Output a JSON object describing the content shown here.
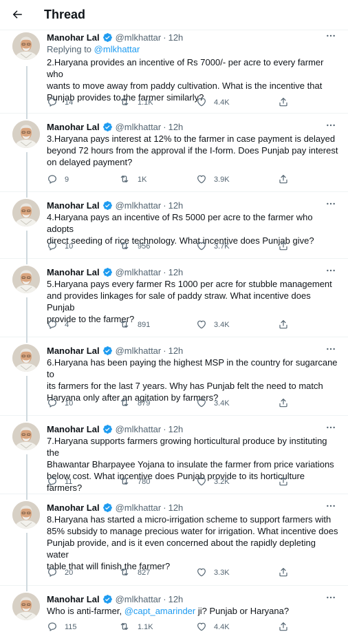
{
  "header": {
    "title": "Thread"
  },
  "colors": {
    "accent": "#1d9bf0",
    "text": "#0f1419",
    "secondary": "#536471",
    "divider": "#eff3f4"
  },
  "icons": {
    "back": "arrow-left-icon",
    "verified": "verified-badge-icon",
    "more": "more-horizontal-icon",
    "reply": "reply-icon",
    "retweet": "retweet-icon",
    "like": "heart-icon",
    "share": "share-icon"
  },
  "tweets": [
    {
      "name": "Manohar Lal",
      "handle": "@mlkhattar",
      "time": "12h",
      "replying_prefix": "Replying to",
      "replying_to": "@mlkhattar",
      "lines": [
        "2.Haryana provides an incentive of Rs 7000/- per acre to every farmer who",
        "wants to move away from paddy cultivation. What is the incentive that",
        "Punjab provides to the farmer similarly?"
      ],
      "replies": "14",
      "retweets": "1.1K",
      "likes": "4.4K"
    },
    {
      "name": "Manohar Lal",
      "handle": "@mlkhattar",
      "time": "12h",
      "lines": [
        "3.Haryana pays interest at 12% to the farmer in case payment is delayed",
        "beyond 72 hours from the approval if the I-form. Does Punjab pay interest",
        "on delayed payment?"
      ],
      "replies": "9",
      "retweets": "1K",
      "likes": "3.9K"
    },
    {
      "name": "Manohar Lal",
      "handle": "@mlkhattar",
      "time": "12h",
      "lines": [
        "4.Haryana pays an incentive of Rs 5000 per acre to the farmer who adopts",
        "direct seeding of rice technology. What incentive does Punjab give?"
      ],
      "replies": "10",
      "retweets": "956",
      "likes": "3.7K"
    },
    {
      "name": "Manohar Lal",
      "handle": "@mlkhattar",
      "time": "12h",
      "lines": [
        "5.Haryana pays every farmer Rs 1000 per acre for stubble management",
        "and provides linkages for sale of paddy straw. What incentive does Punjab",
        "provide to the farmer?"
      ],
      "replies": "4",
      "retweets": "891",
      "likes": "3.4K"
    },
    {
      "name": "Manohar Lal",
      "handle": "@mlkhattar",
      "time": "12h",
      "lines": [
        "6.Haryana has been paying the highest MSP in the country for sugarcane to",
        "its farmers for the last 7 years. Why has Punjab felt the need to match",
        "Haryana only after an agitation by farmers?"
      ],
      "replies": "10",
      "retweets": "879",
      "likes": "3.4K"
    },
    {
      "name": "Manohar Lal",
      "handle": "@mlkhattar",
      "time": "12h",
      "lines": [
        "7.Haryana supports farmers growing horticultural produce by instituting the",
        "Bhawantar Bharpayee Yojana to insulate the farmer from price variations",
        "below cost. What incentive does Punjab provide to its horticulture farmers?"
      ],
      "replies": "11",
      "retweets": "780",
      "likes": "3.2K"
    },
    {
      "name": "Manohar Lal",
      "handle": "@mlkhattar",
      "time": "12h",
      "lines": [
        "8.Haryana has started a micro-irrigation scheme to support farmers with",
        "85% subsidy to manage precious water for irrigation. What incentive does",
        "Punjab provide, and is it even concerned about the rapidly depleting water",
        "table that will finish the farmer?"
      ],
      "replies": "20",
      "retweets": "827",
      "likes": "3.3K"
    },
    {
      "name": "Manohar Lal",
      "handle": "@mlkhattar",
      "time": "12h",
      "text_before": "Who is anti-farmer, ",
      "mention": "@capt_amarinder",
      "text_after": " ji? Punjab or Haryana?",
      "replies": "115",
      "retweets": "1.1K",
      "likes": "4.4K"
    }
  ]
}
